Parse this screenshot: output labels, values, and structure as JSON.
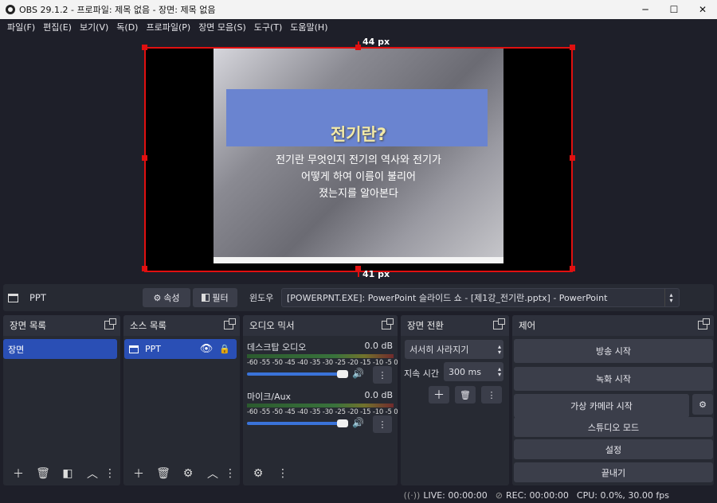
{
  "titlebar": {
    "title": "OBS 29.1.2 - 프로파일: 제목 없음 - 장면: 제목 없음"
  },
  "menu": [
    "파일(F)",
    "편집(E)",
    "보기(V)",
    "독(D)",
    "프로파일(P)",
    "장면 모음(S)",
    "도구(T)",
    "도움말(H)"
  ],
  "preview": {
    "top_px_label": "44 px",
    "bottom_px_label": "41 px",
    "slide_title": "전기란?",
    "slide_body": [
      "전기란 무엇인지 전기의 역사와 전기가",
      "어떻게 하여 이름이 불리어",
      "졌는지를 알아본다"
    ]
  },
  "source_toolbar": {
    "source_name": "PPT",
    "properties_label": "속성",
    "filters_label": "필터",
    "window_label": "윈도우",
    "window_value": "[POWERPNT.EXE]: PowerPoint 슬라이드 쇼 - [제1강_전기란.pptx] - PowerPoint"
  },
  "scenes": {
    "title": "장면 목록",
    "items": [
      "장면"
    ]
  },
  "sources": {
    "title": "소스 목록",
    "items": [
      "PPT"
    ]
  },
  "mixer": {
    "title": "오디오 믹서",
    "channels": [
      {
        "name": "데스크탑 오디오",
        "db": "0.0 dB"
      },
      {
        "name": "마이크/Aux",
        "db": "0.0 dB"
      }
    ],
    "ticks": "-60 -55 -50 -45 -40 -35 -30 -25 -20 -15 -10 -5  0"
  },
  "transitions": {
    "title": "장면 전환",
    "type": "서서히 사라지기",
    "duration_label": "지속 시간",
    "duration_value": "300 ms"
  },
  "controls": {
    "title": "제어",
    "buttons": [
      "방송 시작",
      "녹화 시작",
      "가상 카메라 시작",
      "스튜디오 모드",
      "설정",
      "끝내기"
    ]
  },
  "status": {
    "live": "LIVE: 00:00:00",
    "rec": "REC: 00:00:00",
    "cpu": "CPU: 0.0%, 30.00 fps"
  },
  "colors": {
    "accent": "#2a4fb5",
    "selection_red": "#e01010",
    "bg": "#1e1f29",
    "panel": "#272a33"
  }
}
